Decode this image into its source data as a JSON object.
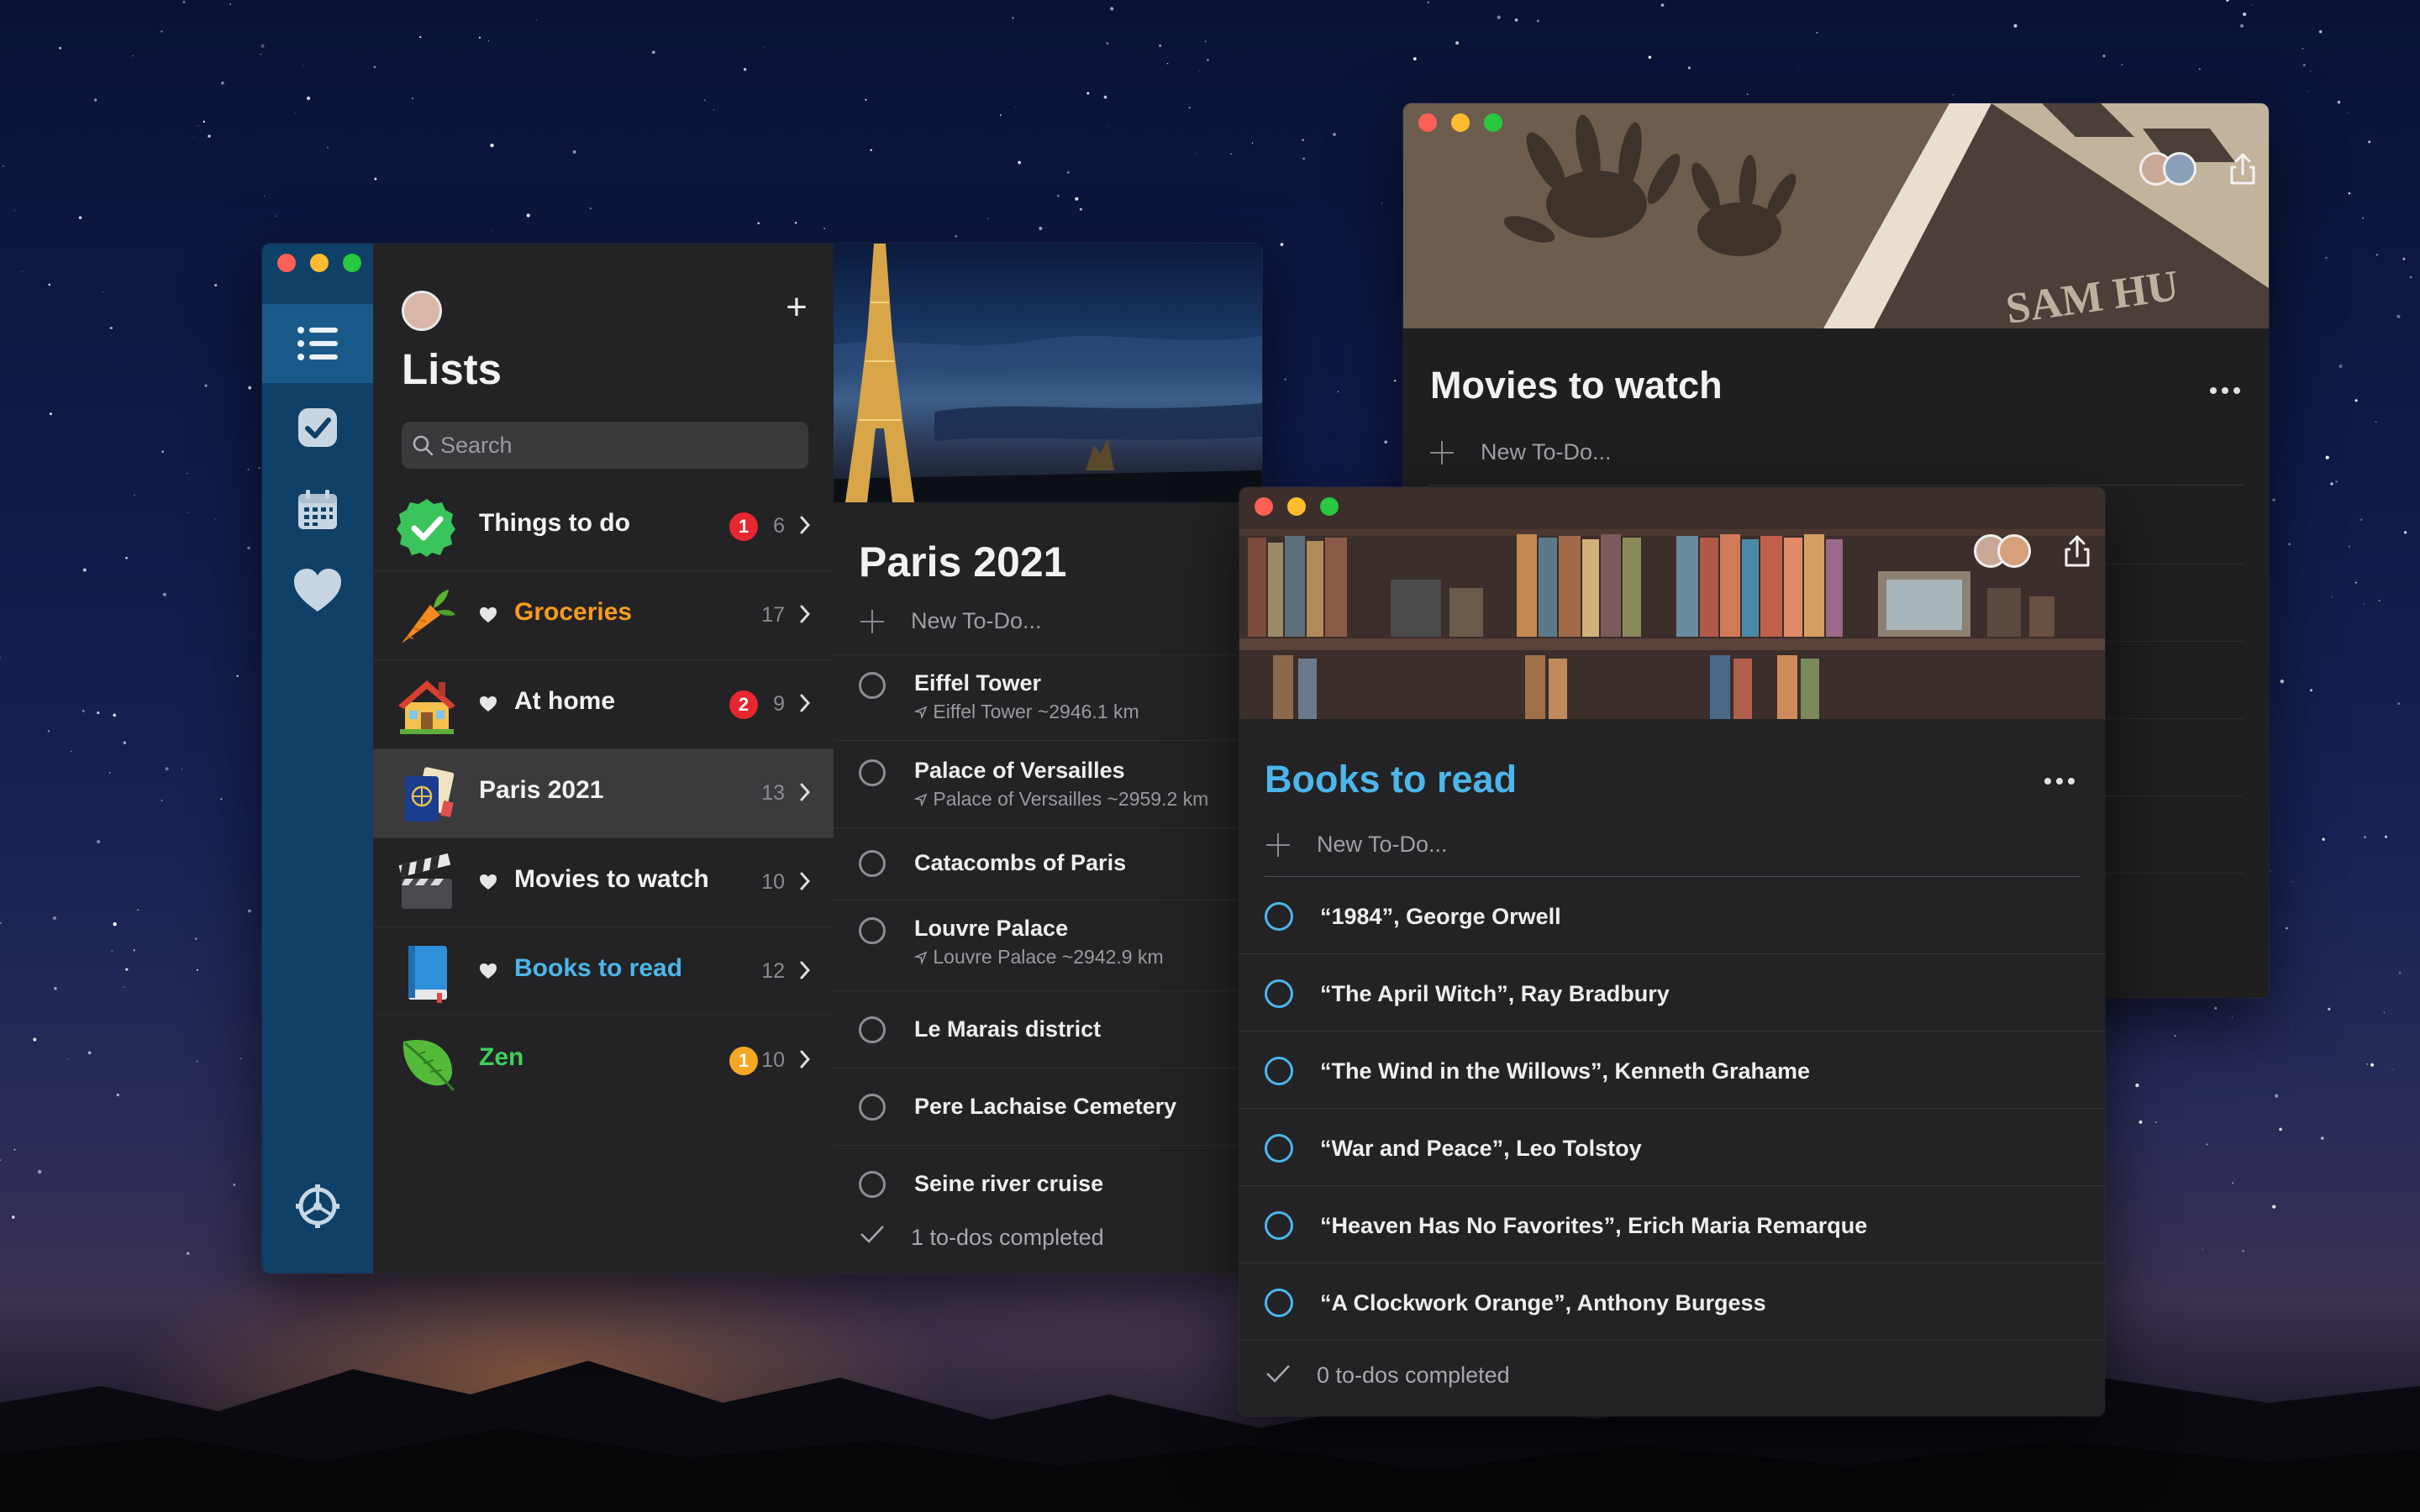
{
  "lists_window": {
    "title": "Lists",
    "search_placeholder": "Search",
    "lists": [
      {
        "name": "Things to do",
        "badge": "1",
        "count": "6",
        "name_color": "#f2f2f2",
        "badge_color": "#e8262f",
        "favorite": false,
        "icon": "green-check-icon"
      },
      {
        "name": "Groceries",
        "badge": "",
        "count": "17",
        "name_color": "#f79b1d",
        "badge_color": "",
        "favorite": true,
        "icon": "carrot-icon"
      },
      {
        "name": "At home",
        "badge": "2",
        "count": "9",
        "name_color": "#f2f2f2",
        "badge_color": "#e8262f",
        "favorite": true,
        "icon": "house-icon"
      },
      {
        "name": "Paris 2021",
        "badge": "",
        "count": "13",
        "name_color": "#f2f2f2",
        "badge_color": "",
        "favorite": false,
        "icon": "passport-icon"
      },
      {
        "name": "Movies to watch",
        "badge": "",
        "count": "10",
        "name_color": "#f2f2f2",
        "badge_color": "",
        "favorite": true,
        "icon": "clapperboard-icon"
      },
      {
        "name": "Books to read",
        "badge": "",
        "count": "12",
        "name_color": "#4cb6ea",
        "badge_color": "",
        "favorite": true,
        "icon": "blue-book-icon"
      },
      {
        "name": "Zen",
        "badge": "1",
        "count": "10",
        "name_color": "#3fcf5c",
        "badge_color": "#f5a623",
        "favorite": false,
        "icon": "leaf-icon"
      }
    ]
  },
  "paris": {
    "title": "Paris 2021",
    "new_todo": "New To-Do...",
    "todos": [
      {
        "title": "Eiffel Tower",
        "location": "Eiffel Tower ~2946.1 km"
      },
      {
        "title": "Palace of Versailles",
        "location": "Palace of Versailles ~2959.2 km"
      },
      {
        "title": "Catacombs of Paris",
        "location": ""
      },
      {
        "title": "Louvre Palace",
        "location": "Louvre Palace ~2942.9 km"
      },
      {
        "title": "Le Marais district",
        "location": ""
      },
      {
        "title": "Pere Lachaise Cemetery",
        "location": ""
      },
      {
        "title": "Seine river cruise",
        "location": ""
      }
    ],
    "completed": "1 to-dos completed"
  },
  "movies": {
    "title": "Movies to watch",
    "new_todo": "New To-Do..."
  },
  "books": {
    "title": "Books to read",
    "title_color": "#4cb6ea",
    "new_todo": "New To-Do...",
    "todos": [
      "“1984”, George Orwell",
      "“The April Witch”, Ray Bradbury",
      "“The Wind in the Willows”, Kenneth Grahame",
      "“War and Peace”, Leo Tolstoy",
      "“Heaven Has No Favorites”, Erich Maria Remarque",
      "“A Clockwork Orange”, Anthony Burgess"
    ],
    "completed": "0 to-dos completed"
  },
  "rail_icons": [
    "list-icon",
    "checkmark-icon",
    "calendar-icon",
    "heart-icon",
    "settings-icon"
  ]
}
